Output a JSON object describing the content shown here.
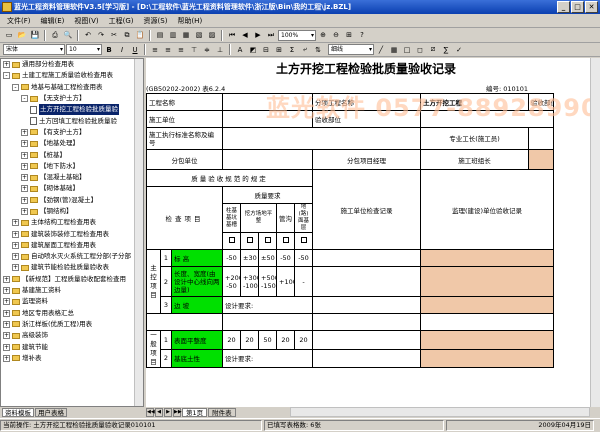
{
  "window": {
    "title": "蓝光工程资料管理软件V3.5[学习版] - [D:\\工程软件\\蓝光工程资料管理软件\\浙江版\\Bin\\我的工程\\jz.BZL]"
  },
  "menu": [
    "文件(F)",
    "编辑(E)",
    "视图(V)",
    "工程(G)",
    "资源(S)",
    "帮助(H)"
  ],
  "toolbar": {
    "zoom": "100%"
  },
  "format": {
    "font": "宋体",
    "size": "10",
    "line_style": "细线"
  },
  "tree": [
    {
      "level": 0,
      "exp": "+",
      "icon": "folder",
      "label": "通用部分检查用表"
    },
    {
      "level": 0,
      "exp": "-",
      "icon": "folder",
      "label": "土建工程施工质量验收检查用表"
    },
    {
      "level": 1,
      "exp": "-",
      "icon": "folder",
      "label": "地基与基础工程检查用表"
    },
    {
      "level": 2,
      "exp": "-",
      "icon": "folder",
      "label": "【无支护土方】"
    },
    {
      "level": 3,
      "exp": "",
      "icon": "doc",
      "label": "土方开挖工程检验批质量验",
      "selected": true
    },
    {
      "level": 3,
      "exp": "",
      "icon": "doc",
      "label": "土方回填工程检验批质量验"
    },
    {
      "level": 2,
      "exp": "+",
      "icon": "folder",
      "label": "【有支护土方】"
    },
    {
      "level": 2,
      "exp": "+",
      "icon": "folder",
      "label": "【地基处理】"
    },
    {
      "level": 2,
      "exp": "+",
      "icon": "folder",
      "label": "【桩基】"
    },
    {
      "level": 2,
      "exp": "+",
      "icon": "folder",
      "label": "【地下防水】"
    },
    {
      "level": 2,
      "exp": "+",
      "icon": "folder",
      "label": "【混凝土基础】"
    },
    {
      "level": 2,
      "exp": "+",
      "icon": "folder",
      "label": "【砌体基础】"
    },
    {
      "level": 2,
      "exp": "+",
      "icon": "folder",
      "label": "【劲钢(管)混凝土】"
    },
    {
      "level": 2,
      "exp": "+",
      "icon": "folder",
      "label": "【钢结构】"
    },
    {
      "level": 1,
      "exp": "+",
      "icon": "folder",
      "label": "主体结构工程检查用表"
    },
    {
      "level": 1,
      "exp": "+",
      "icon": "folder",
      "label": "建筑装饰装修工程检查用表"
    },
    {
      "level": 1,
      "exp": "+",
      "icon": "folder",
      "label": "建筑屋面工程检查用表"
    },
    {
      "level": 1,
      "exp": "+",
      "icon": "folder",
      "label": "自动喷水灭火系统工程分部(子分部"
    },
    {
      "level": 1,
      "exp": "+",
      "icon": "folder",
      "label": "建筑节能检验批质量验收表"
    },
    {
      "level": 0,
      "exp": "+",
      "icon": "folder",
      "label": "【新规范】工程质量验收配套检查用"
    },
    {
      "level": 0,
      "exp": "+",
      "icon": "folder",
      "label": "基建施工资料"
    },
    {
      "level": 0,
      "exp": "+",
      "icon": "folder",
      "label": "监理资料"
    },
    {
      "level": 0,
      "exp": "+",
      "icon": "folder",
      "label": "地区专用表格汇总"
    },
    {
      "level": 0,
      "exp": "+",
      "icon": "folder",
      "label": "浙江样板(优质工程)用表"
    },
    {
      "level": 0,
      "exp": "+",
      "icon": "folder",
      "label": "高级装饰"
    },
    {
      "level": 0,
      "exp": "+",
      "icon": "folder",
      "label": "建筑节能"
    },
    {
      "level": 0,
      "exp": "+",
      "icon": "folder",
      "label": "增补表"
    }
  ],
  "left_tabs": [
    "资料模板",
    "用户表格"
  ],
  "document": {
    "title": "土方开挖工程检验批质量验收记录",
    "watermark": "蓝光软件 0577-88928990",
    "gb_ref": "(GB50202-2002) 表6.2.4",
    "no_label": "编号: 010101",
    "labels": {
      "project_name": "工程名称",
      "subproject": "分项工程名称",
      "subproject_value": "土方开挖工程",
      "inspection_lot": "验收部位",
      "construction_unit": "施工单位",
      "standard": "施工执行标准名称及编号",
      "foreman": "专业工长(施工员)",
      "subcontractor": "分包单位",
      "sub_pm": "分包项目经理",
      "team_leader": "施工班组长",
      "spec_header": "质量验收规范的规定",
      "check_items": "检查项目",
      "quality_req": "质量要求",
      "pile_base": "柱基基坑基槽",
      "excavation_site": "挖方场地平整",
      "manual": "人工",
      "machine": "机械",
      "pipe_ditch": "管沟",
      "ground_base": "地(路)面基层",
      "constr_record": "施工单位检查记录",
      "supervision_record": "监理(建设)单位验收记录",
      "main_control": "主控项目",
      "general": "一般项目"
    },
    "rows": [
      {
        "no": "1",
        "item": "标  高",
        "vals": [
          "-50",
          "±30",
          "±50",
          "-50",
          "-50"
        ]
      },
      {
        "no": "2",
        "item": "长度、宽度(由设计中心线向两边量)",
        "vals": [
          "+200 -50",
          "+300 -100",
          "+500 -150",
          "+100",
          ""
        ]
      },
      {
        "no": "3",
        "item": "边    坡",
        "design": "设计要求:"
      },
      {
        "no": "1",
        "item": "表面平整度",
        "vals": [
          "20",
          "20",
          "50",
          "20",
          "20"
        ]
      },
      {
        "no": "2",
        "item": "基底土性",
        "design": "设计要求:"
      }
    ]
  },
  "sheet_tabs": [
    "第1页",
    "附件表"
  ],
  "status": {
    "current": "当前操作: 土方开挖工程检验批质量验收记录010101",
    "filled": "已填写表格数: 6张",
    "date": "2009年04月19日"
  }
}
